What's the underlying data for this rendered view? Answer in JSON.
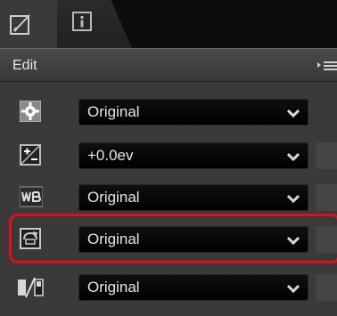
{
  "tabs": [
    {
      "name": "edit",
      "icon": "edit-icon"
    },
    {
      "name": "info",
      "icon": "info-icon"
    }
  ],
  "header": {
    "title": "Edit",
    "menu_icon": "panel-menu-icon"
  },
  "rows": [
    {
      "icon": "camera-settings-icon",
      "value": "Original"
    },
    {
      "icon": "exposure-compensation-icon",
      "value": "+0.0ev"
    },
    {
      "icon": "white-balance-icon",
      "value": "Original"
    },
    {
      "icon": "picture-control-icon",
      "value": "Original"
    },
    {
      "icon": "light-dark-adjust-icon",
      "value": "Original"
    }
  ],
  "colors": {
    "highlight": "#e30d1f",
    "panel": "#3a3a3a",
    "dropdown": "#0a0a0a"
  }
}
